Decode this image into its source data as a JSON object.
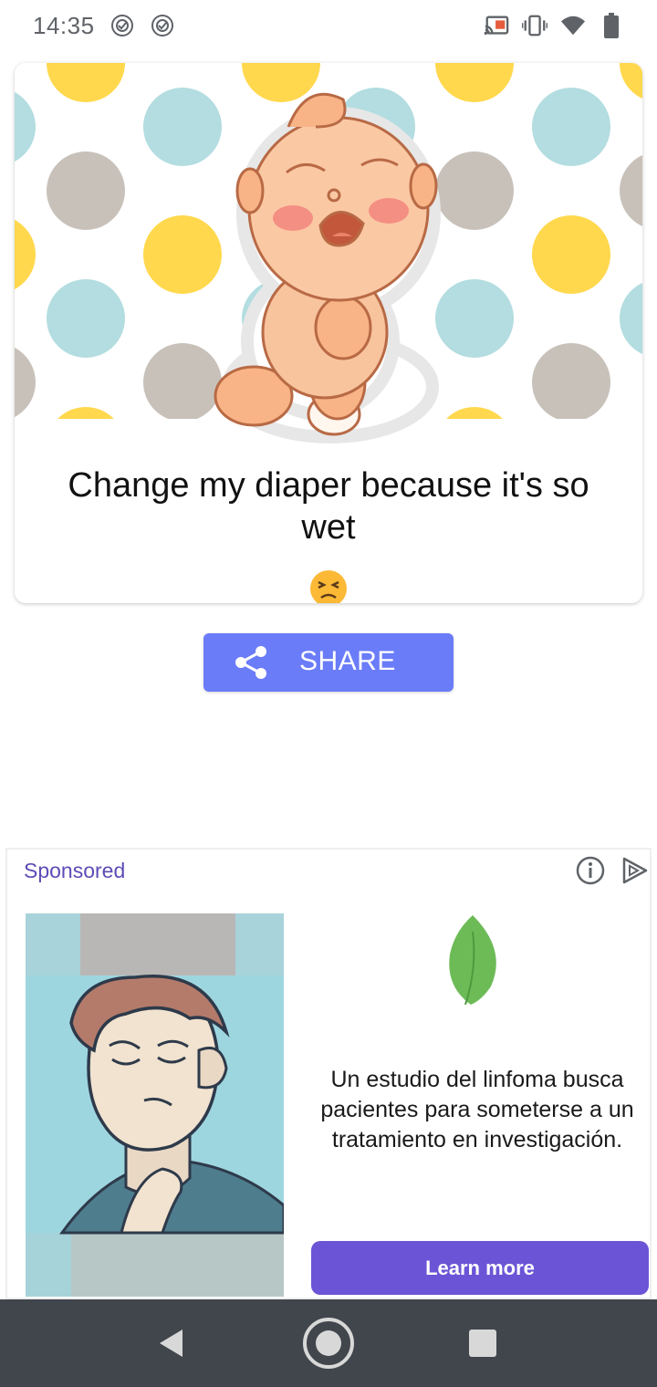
{
  "status_bar": {
    "time": "14:35",
    "left_icons": [
      "notification-app-icon",
      "notification-app-icon"
    ],
    "right_icons": [
      "cast-icon",
      "vibrate-icon",
      "wifi-icon",
      "battery-icon"
    ]
  },
  "card": {
    "image_description_icon": "crying-baby-illustration",
    "caption": "Change my diaper because it's so wet",
    "emoji": "😣",
    "colors": {
      "dot_yellow": "#ffd84d",
      "dot_blue": "#b3dde0",
      "dot_gray": "#c8c1ba"
    }
  },
  "share_button": {
    "label": "SHARE",
    "icon": "share-icon",
    "color": "#6a7cf8"
  },
  "ad": {
    "sponsored_label": "Sponsored",
    "info_icon": "info-icon",
    "choices_icon": "ad-choices-icon",
    "leaf_icon": "leaf-icon",
    "image_icon": "man-sore-throat-illustration",
    "body_text": "Un estudio del linfoma busca pacientes para someterse a un tratamiento en investigación.",
    "cta_label": "Learn more",
    "cta_color": "#6b55d6"
  },
  "nav_bar": {
    "back_icon": "back-icon",
    "home_icon": "home-icon",
    "recents_icon": "recents-icon"
  }
}
